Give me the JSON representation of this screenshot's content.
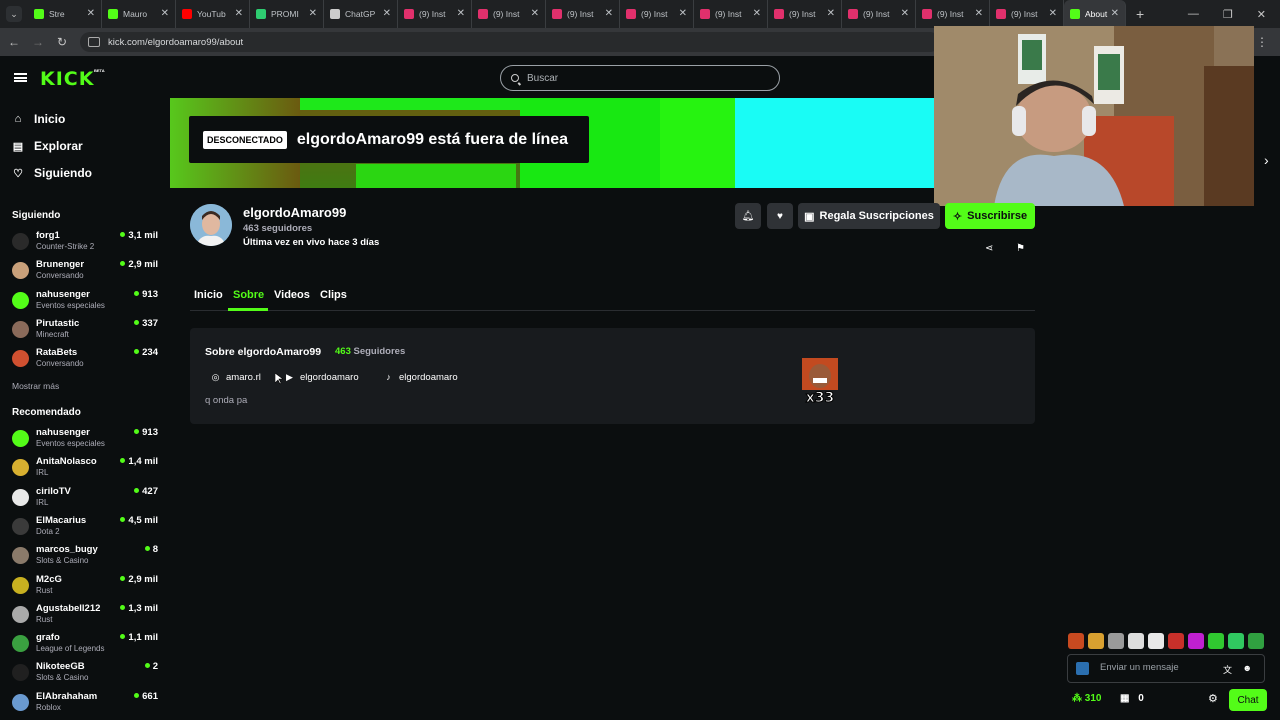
{
  "browser": {
    "tabs": [
      {
        "title": "Stre",
        "color": "#53fc18",
        "active": false
      },
      {
        "title": "Mauro",
        "color": "#53fc18",
        "active": false
      },
      {
        "title": "YouTub",
        "color": "#ff0000",
        "active": false
      },
      {
        "title": "PROMI",
        "color": "#2ecc71",
        "active": false
      },
      {
        "title": "ChatGP",
        "color": "#cccccc",
        "active": false
      },
      {
        "title": "(9) Inst",
        "color": "#e1306c",
        "active": false
      },
      {
        "title": "(9) Inst",
        "color": "#e1306c",
        "active": false
      },
      {
        "title": "(9) Inst",
        "color": "#e1306c",
        "active": false
      },
      {
        "title": "(9) Inst",
        "color": "#e1306c",
        "active": false
      },
      {
        "title": "(9) Inst",
        "color": "#e1306c",
        "active": false
      },
      {
        "title": "(9) Inst",
        "color": "#e1306c",
        "active": false
      },
      {
        "title": "(9) Inst",
        "color": "#e1306c",
        "active": false
      },
      {
        "title": "(9) Inst",
        "color": "#e1306c",
        "active": false
      },
      {
        "title": "(9) Inst",
        "color": "#e1306c",
        "active": false
      },
      {
        "title": "About",
        "color": "#53fc18",
        "active": true
      }
    ],
    "url": "kick.com/elgordoamaro99/about"
  },
  "header": {
    "logo": "KICK",
    "beta": "BETA",
    "search_placeholder": "Buscar"
  },
  "sidebar": {
    "nav": [
      {
        "label": "Inicio",
        "icon": "home-icon"
      },
      {
        "label": "Explorar",
        "icon": "compass-icon"
      },
      {
        "label": "Siguiendo",
        "icon": "heart-icon"
      }
    ],
    "following_title": "Siguiendo",
    "following": [
      {
        "name": "forg1",
        "category": "Counter-Strike 2",
        "viewers": "3,1 mil",
        "color": "#2a2a2a"
      },
      {
        "name": "Brunenger",
        "category": "Conversando",
        "viewers": "2,9 mil",
        "color": "#c9a07a"
      },
      {
        "name": "nahusenger",
        "category": "Eventos especiales",
        "viewers": "913",
        "color": "#53fc18"
      },
      {
        "name": "Pirutastic",
        "category": "Minecraft",
        "viewers": "337",
        "color": "#8a6a5a"
      },
      {
        "name": "RataBets",
        "category": "Conversando",
        "viewers": "234",
        "color": "#d05030"
      }
    ],
    "show_more": "Mostrar más",
    "recommended_title": "Recomendado",
    "recommended": [
      {
        "name": "nahusenger",
        "category": "Eventos especiales",
        "viewers": "913",
        "color": "#53fc18"
      },
      {
        "name": "AnitaNolasco",
        "category": "IRL",
        "viewers": "1,4 mil",
        "color": "#d8b030"
      },
      {
        "name": "ciriloTV",
        "category": "IRL",
        "viewers": "427",
        "color": "#e8e8e8"
      },
      {
        "name": "ElMacarius",
        "category": "Dota 2",
        "viewers": "4,5 mil",
        "color": "#3a3a3a"
      },
      {
        "name": "marcos_bugy",
        "category": "Slots & Casino",
        "viewers": "8",
        "color": "#8a7a6a"
      },
      {
        "name": "M2cG",
        "category": "Rust",
        "viewers": "2,9 mil",
        "color": "#c8b020"
      },
      {
        "name": "Agustabell212",
        "category": "Rust",
        "viewers": "1,3 mil",
        "color": "#aaaaaa"
      },
      {
        "name": "grafo",
        "category": "League of Legends",
        "viewers": "1,1 mil",
        "color": "#3aa040"
      },
      {
        "name": "NikoteeGB",
        "category": "Slots & Casino",
        "viewers": "2",
        "color": "#202020"
      },
      {
        "name": "ElAbrahaham",
        "category": "Roblox",
        "viewers": "661",
        "color": "#6a9ad0"
      }
    ]
  },
  "banner": {
    "badge": "DESCONECTADO",
    "offline_text": "elgordoAmaro99 está fuera de línea"
  },
  "profile": {
    "name": "elgordoAmaro99",
    "followers": "463 seguidores",
    "last_live": "Última vez en vivo hace 3 días",
    "gift_label": "Regala Suscripciones",
    "subscribe_label": "Suscribirse"
  },
  "tabs": [
    "Inicio",
    "Sobre",
    "Videos",
    "Clips"
  ],
  "about": {
    "title": "Sobre elgordoAmaro99",
    "followers_count": "463",
    "followers_label": "Seguidores",
    "socials": [
      {
        "label": "amaro.rl",
        "icon": "instagram-icon"
      },
      {
        "label": "elgordoamaro",
        "icon": "youtube-icon"
      },
      {
        "label": "elgordoamaro",
        "icon": "tiktok-icon"
      }
    ],
    "bio": "q onda pa",
    "emote_text": "x33"
  },
  "chat": {
    "placeholder": "Enviar un mensaje",
    "points": "310",
    "store": "0",
    "chat_button": "Chat"
  }
}
